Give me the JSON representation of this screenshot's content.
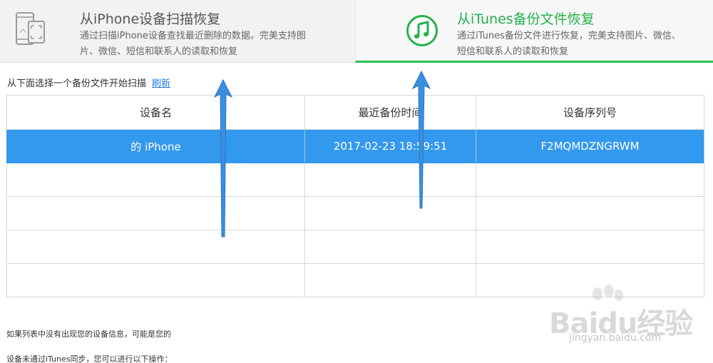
{
  "tabs": {
    "scan_device": {
      "title": "从iPhone设备扫描恢复",
      "description": "通过扫描iPhone设备查找最近删除的数据。完美支持图片、微信、短信和联系人的读取和恢复",
      "icon": "phone-scan-icon"
    },
    "itunes_backup": {
      "title": "从iTunes备份文件恢复",
      "description": "通过iTunes备份文件进行恢复，完美支持图片、微信、短信和联系人的读取和恢复",
      "icon": "music-note-icon",
      "accent_color": "#22b14c"
    }
  },
  "select_prompt": "从下面选择一个备份文件开始扫描",
  "refresh_label": "刷新",
  "table": {
    "headers": [
      "设备名",
      "最近备份时间",
      "设备序列号"
    ],
    "rows": [
      {
        "name": "的 iPhone",
        "time": "2017-02-23 18:59:51",
        "serial": "F2MQMDZNGRWM",
        "selected": true
      }
    ],
    "empty_rows": 4,
    "selected_color": "#3399ee"
  },
  "info": {
    "line1": "如果列表中没有出现您的设备信息，可能是您的",
    "line2": "设备未通过iTunes同步，您可以进行以下操作："
  },
  "watermark": {
    "brand": "Baidu经验",
    "url": "jingyan.baidu.com"
  }
}
